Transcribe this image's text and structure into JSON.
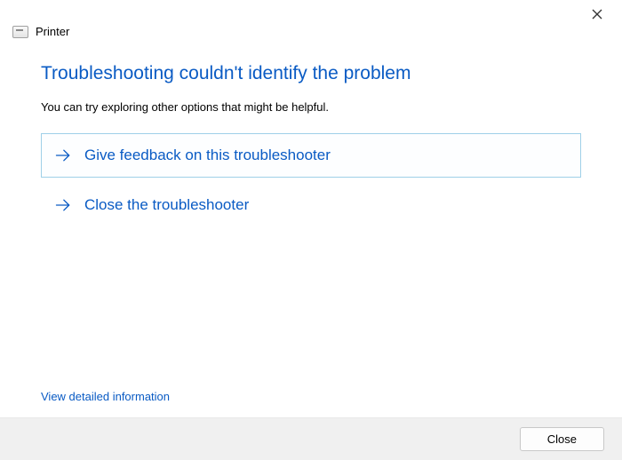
{
  "window": {
    "title": "Printer"
  },
  "main": {
    "heading": "Troubleshooting couldn't identify the problem",
    "subtext": "You can try exploring other options that might be helpful."
  },
  "options": {
    "feedback": "Give feedback on this troubleshooter",
    "close": "Close the troubleshooter"
  },
  "detail_link": "View detailed information",
  "footer": {
    "close_label": "Close"
  }
}
